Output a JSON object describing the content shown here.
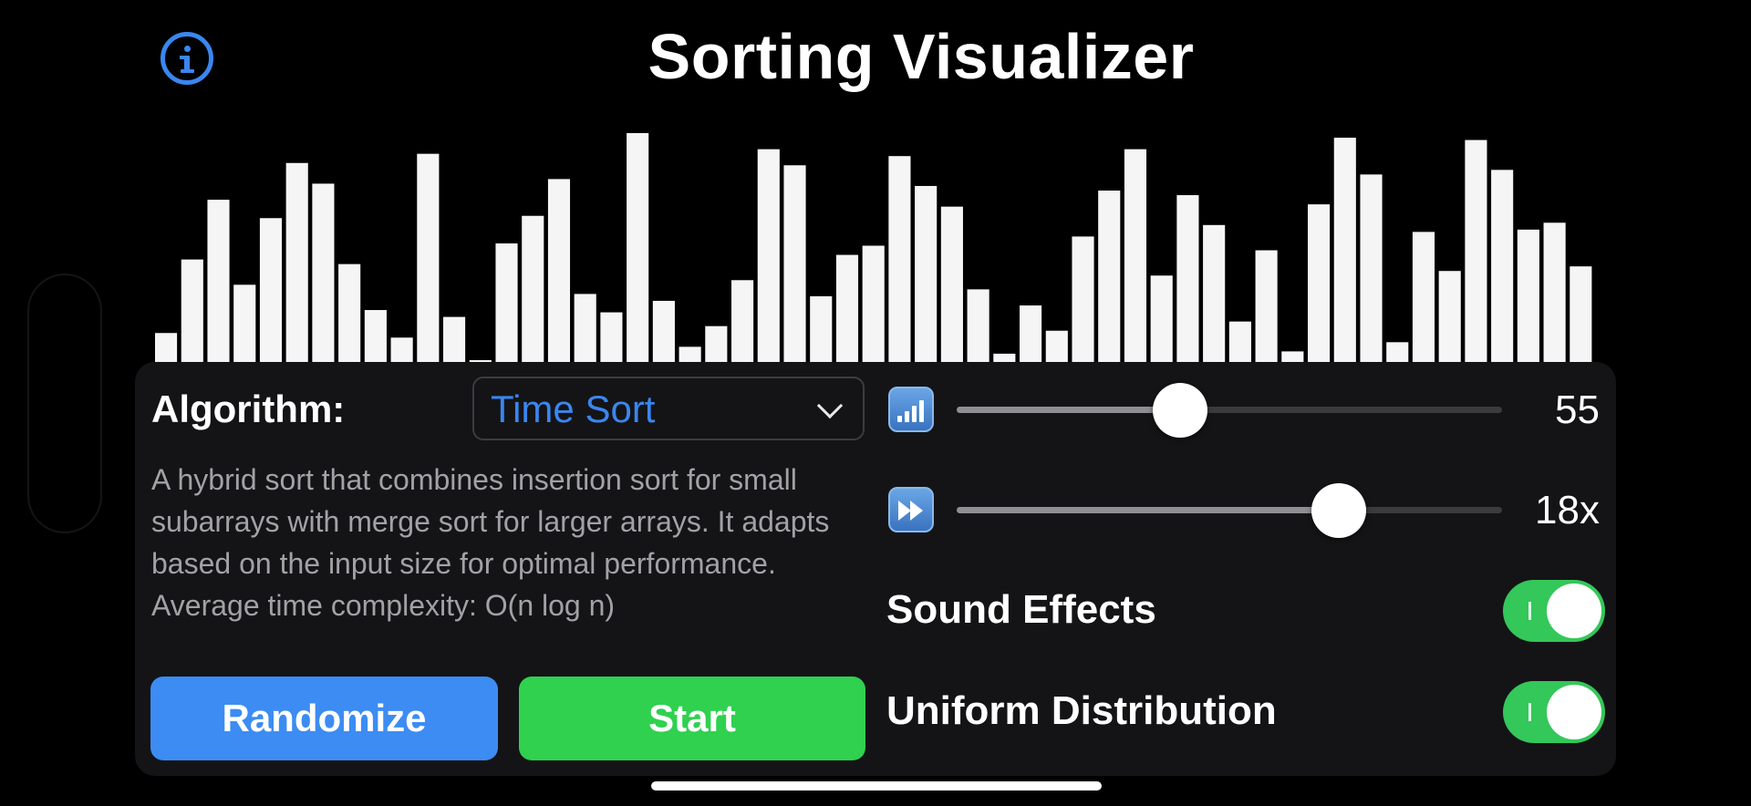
{
  "title": "Sorting Visualizer",
  "chart_data": {
    "type": "bar",
    "ylim": [
      0,
      100
    ],
    "values": [
      13,
      45,
      71,
      34,
      63,
      87,
      78,
      43,
      23,
      11,
      91,
      20,
      1,
      52,
      64,
      80,
      30,
      22,
      100,
      27,
      7,
      16,
      36,
      93,
      86,
      29,
      47,
      51,
      90,
      77,
      68,
      32,
      4,
      25,
      14,
      55,
      75,
      93,
      38,
      73,
      60,
      18,
      49,
      5,
      69,
      98,
      82,
      9,
      57,
      40,
      97,
      84,
      58,
      61,
      42
    ]
  },
  "info_icon": "info-circle-icon",
  "controls": {
    "algorithm_label": "Algorithm:",
    "algorithm_value": "Time Sort",
    "description": "A hybrid sort that combines insertion sort for small subarrays with merge sort for larger arrays. It adapts based on the input size for optimal performance. Average time complexity: O(n log n)",
    "randomize_label": "Randomize",
    "start_label": "Start",
    "size_slider": {
      "icon": "signal-bars-icon",
      "value_label": "55",
      "fraction": 0.41
    },
    "speed_slider": {
      "icon": "fast-forward-icon",
      "value_label": "18x",
      "fraction": 0.7
    },
    "toggles": [
      {
        "label": "Sound Effects",
        "on": true
      },
      {
        "label": "Uniform Distribution",
        "on": true
      }
    ]
  },
  "colors": {
    "accent": "#3a86f0",
    "start": "#2fd14f",
    "randomize": "#3c8cf3",
    "toggle_on": "#34c759",
    "bar": "#f5f5f5"
  }
}
